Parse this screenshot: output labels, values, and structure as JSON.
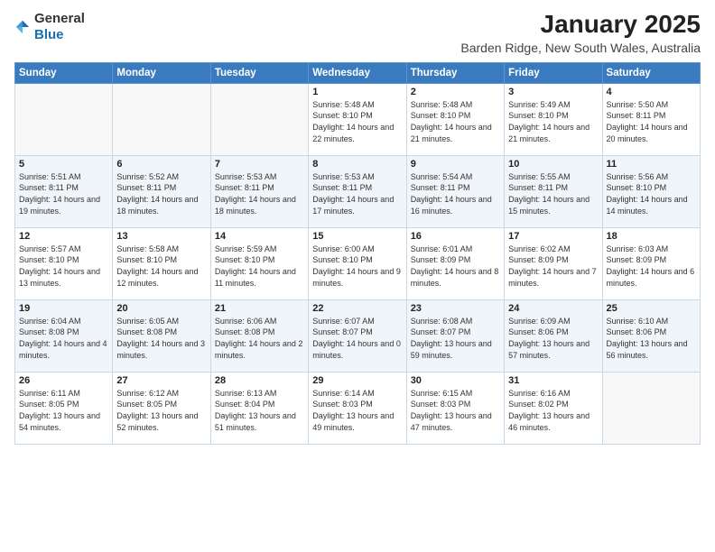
{
  "logo": {
    "general": "General",
    "blue": "Blue"
  },
  "header": {
    "month": "January 2025",
    "location": "Barden Ridge, New South Wales, Australia"
  },
  "weekdays": [
    "Sunday",
    "Monday",
    "Tuesday",
    "Wednesday",
    "Thursday",
    "Friday",
    "Saturday"
  ],
  "weeks": [
    [
      {
        "day": "",
        "sunrise": "",
        "sunset": "",
        "daylight": ""
      },
      {
        "day": "",
        "sunrise": "",
        "sunset": "",
        "daylight": ""
      },
      {
        "day": "",
        "sunrise": "",
        "sunset": "",
        "daylight": ""
      },
      {
        "day": "1",
        "sunrise": "5:48 AM",
        "sunset": "8:10 PM",
        "daylight": "14 hours and 22 minutes."
      },
      {
        "day": "2",
        "sunrise": "5:48 AM",
        "sunset": "8:10 PM",
        "daylight": "14 hours and 21 minutes."
      },
      {
        "day": "3",
        "sunrise": "5:49 AM",
        "sunset": "8:10 PM",
        "daylight": "14 hours and 21 minutes."
      },
      {
        "day": "4",
        "sunrise": "5:50 AM",
        "sunset": "8:11 PM",
        "daylight": "14 hours and 20 minutes."
      }
    ],
    [
      {
        "day": "5",
        "sunrise": "5:51 AM",
        "sunset": "8:11 PM",
        "daylight": "14 hours and 19 minutes."
      },
      {
        "day": "6",
        "sunrise": "5:52 AM",
        "sunset": "8:11 PM",
        "daylight": "14 hours and 18 minutes."
      },
      {
        "day": "7",
        "sunrise": "5:53 AM",
        "sunset": "8:11 PM",
        "daylight": "14 hours and 18 minutes."
      },
      {
        "day": "8",
        "sunrise": "5:53 AM",
        "sunset": "8:11 PM",
        "daylight": "14 hours and 17 minutes."
      },
      {
        "day": "9",
        "sunrise": "5:54 AM",
        "sunset": "8:11 PM",
        "daylight": "14 hours and 16 minutes."
      },
      {
        "day": "10",
        "sunrise": "5:55 AM",
        "sunset": "8:11 PM",
        "daylight": "14 hours and 15 minutes."
      },
      {
        "day": "11",
        "sunrise": "5:56 AM",
        "sunset": "8:10 PM",
        "daylight": "14 hours and 14 minutes."
      }
    ],
    [
      {
        "day": "12",
        "sunrise": "5:57 AM",
        "sunset": "8:10 PM",
        "daylight": "14 hours and 13 minutes."
      },
      {
        "day": "13",
        "sunrise": "5:58 AM",
        "sunset": "8:10 PM",
        "daylight": "14 hours and 12 minutes."
      },
      {
        "day": "14",
        "sunrise": "5:59 AM",
        "sunset": "8:10 PM",
        "daylight": "14 hours and 11 minutes."
      },
      {
        "day": "15",
        "sunrise": "6:00 AM",
        "sunset": "8:10 PM",
        "daylight": "14 hours and 9 minutes."
      },
      {
        "day": "16",
        "sunrise": "6:01 AM",
        "sunset": "8:09 PM",
        "daylight": "14 hours and 8 minutes."
      },
      {
        "day": "17",
        "sunrise": "6:02 AM",
        "sunset": "8:09 PM",
        "daylight": "14 hours and 7 minutes."
      },
      {
        "day": "18",
        "sunrise": "6:03 AM",
        "sunset": "8:09 PM",
        "daylight": "14 hours and 6 minutes."
      }
    ],
    [
      {
        "day": "19",
        "sunrise": "6:04 AM",
        "sunset": "8:08 PM",
        "daylight": "14 hours and 4 minutes."
      },
      {
        "day": "20",
        "sunrise": "6:05 AM",
        "sunset": "8:08 PM",
        "daylight": "14 hours and 3 minutes."
      },
      {
        "day": "21",
        "sunrise": "6:06 AM",
        "sunset": "8:08 PM",
        "daylight": "14 hours and 2 minutes."
      },
      {
        "day": "22",
        "sunrise": "6:07 AM",
        "sunset": "8:07 PM",
        "daylight": "14 hours and 0 minutes."
      },
      {
        "day": "23",
        "sunrise": "6:08 AM",
        "sunset": "8:07 PM",
        "daylight": "13 hours and 59 minutes."
      },
      {
        "day": "24",
        "sunrise": "6:09 AM",
        "sunset": "8:06 PM",
        "daylight": "13 hours and 57 minutes."
      },
      {
        "day": "25",
        "sunrise": "6:10 AM",
        "sunset": "8:06 PM",
        "daylight": "13 hours and 56 minutes."
      }
    ],
    [
      {
        "day": "26",
        "sunrise": "6:11 AM",
        "sunset": "8:05 PM",
        "daylight": "13 hours and 54 minutes."
      },
      {
        "day": "27",
        "sunrise": "6:12 AM",
        "sunset": "8:05 PM",
        "daylight": "13 hours and 52 minutes."
      },
      {
        "day": "28",
        "sunrise": "6:13 AM",
        "sunset": "8:04 PM",
        "daylight": "13 hours and 51 minutes."
      },
      {
        "day": "29",
        "sunrise": "6:14 AM",
        "sunset": "8:03 PM",
        "daylight": "13 hours and 49 minutes."
      },
      {
        "day": "30",
        "sunrise": "6:15 AM",
        "sunset": "8:03 PM",
        "daylight": "13 hours and 47 minutes."
      },
      {
        "day": "31",
        "sunrise": "6:16 AM",
        "sunset": "8:02 PM",
        "daylight": "13 hours and 46 minutes."
      },
      {
        "day": "",
        "sunrise": "",
        "sunset": "",
        "daylight": ""
      }
    ]
  ],
  "labels": {
    "sunrise_prefix": "Sunrise: ",
    "sunset_prefix": "Sunset: ",
    "daylight_prefix": "Daylight: "
  }
}
